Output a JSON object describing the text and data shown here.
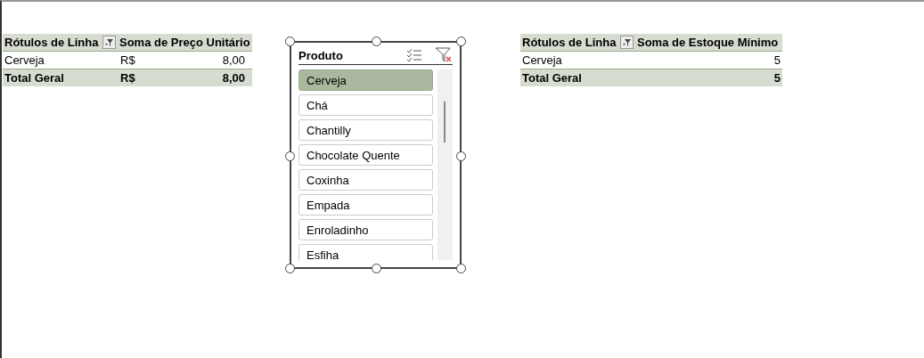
{
  "pivots": [
    {
      "columns": [
        "Rótulos de Linha",
        "Soma de Preço Unitário"
      ],
      "filter_button": true,
      "rows": [
        {
          "kind": "data",
          "label": "Cerveja",
          "currency": "R$",
          "value": "8,00"
        },
        {
          "kind": "total",
          "label": "Total Geral",
          "currency": "R$",
          "value": "8,00"
        }
      ]
    },
    {
      "columns": [
        "Rótulos de Linha",
        "Soma de Estoque Mínimo"
      ],
      "filter_button": true,
      "rows": [
        {
          "kind": "data",
          "label": "Cerveja",
          "value": "5"
        },
        {
          "kind": "total",
          "label": "Total Geral",
          "value": "5"
        }
      ]
    }
  ],
  "slicer": {
    "title": "Produto",
    "items": [
      {
        "label": "Cerveja",
        "selected": true
      },
      {
        "label": "Chá",
        "selected": false
      },
      {
        "label": "Chantilly",
        "selected": false
      },
      {
        "label": "Chocolate Quente",
        "selected": false
      },
      {
        "label": "Coxinha",
        "selected": false
      },
      {
        "label": "Empada",
        "selected": false
      },
      {
        "label": "Enroladinho",
        "selected": false
      },
      {
        "label": "Esfiha",
        "selected": false
      }
    ]
  }
}
